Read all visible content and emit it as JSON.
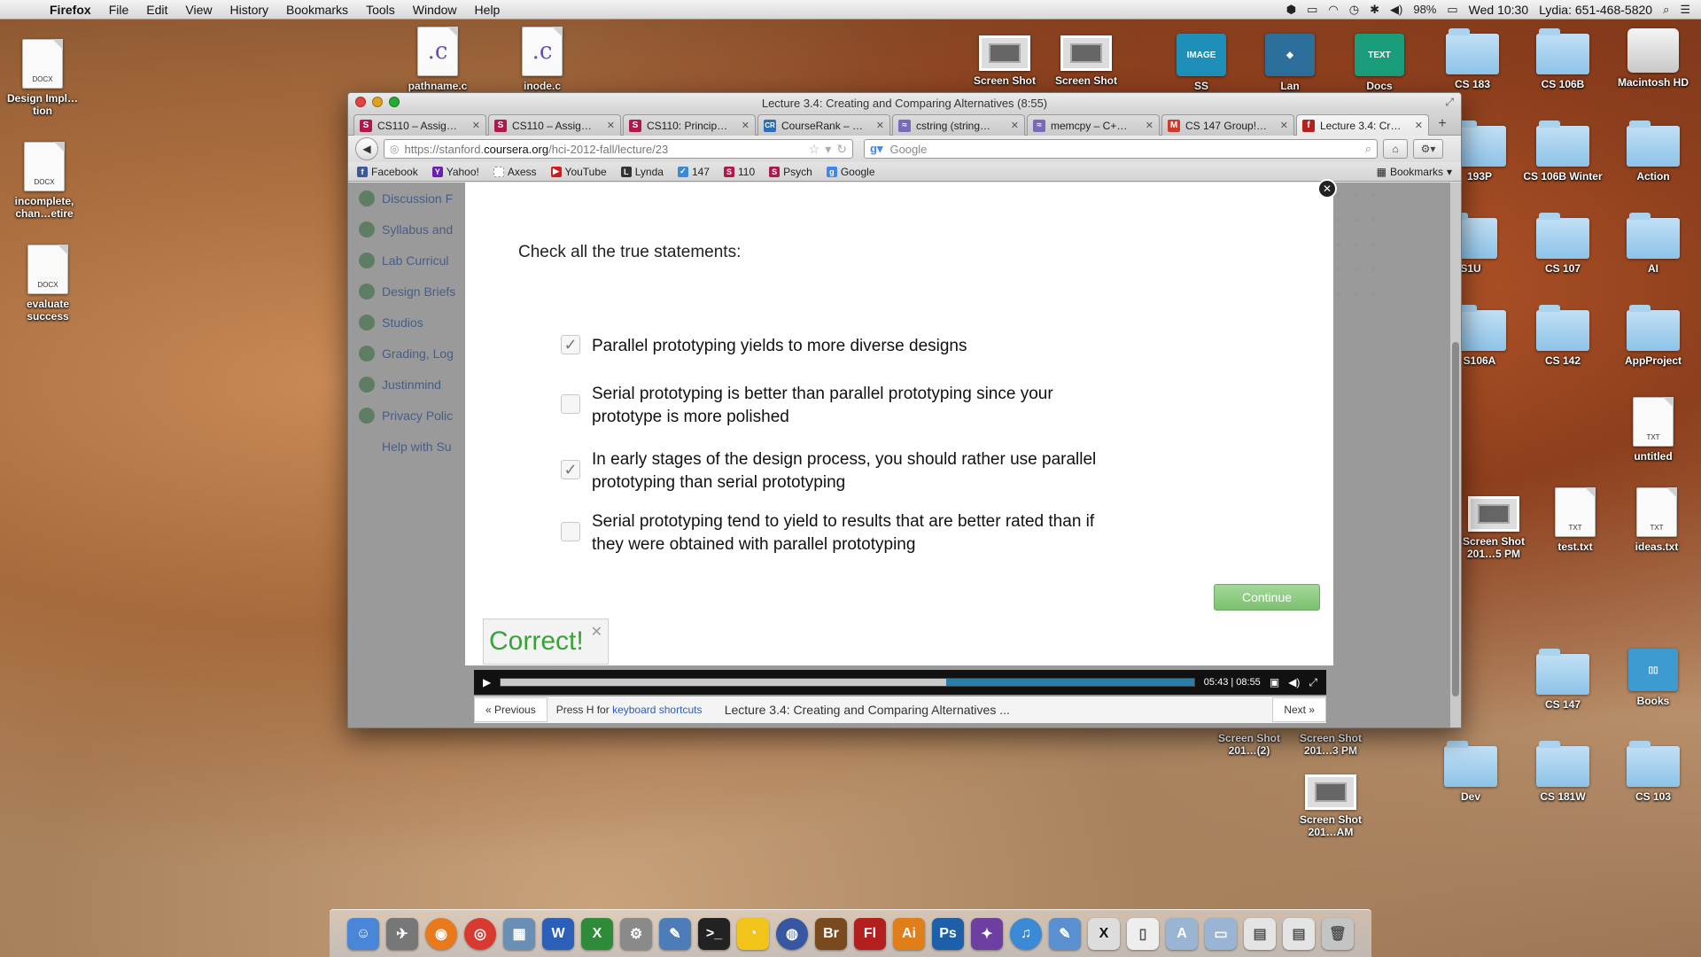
{
  "menubar": {
    "app": "Firefox",
    "items": [
      "File",
      "Edit",
      "View",
      "History",
      "Bookmarks",
      "Tools",
      "Window",
      "Help"
    ],
    "battery": "98%",
    "clock": "Wed 10:30",
    "user": "Lydia: 651-468-5820"
  },
  "desktop": {
    "left": [
      {
        "label": "Design Impl…tion",
        "tag": "DOCX"
      },
      {
        "label": "incomplete, chan…etire",
        "tag": "DOCX"
      },
      {
        "label": "evaluate success",
        "tag": "DOCX"
      }
    ],
    "top": [
      {
        "label": "pathname.c"
      },
      {
        "label": "inode.c"
      },
      {
        "label": "Screen Shot"
      },
      {
        "label": "Screen Shot"
      },
      {
        "label": "SS"
      },
      {
        "label": "Lan"
      },
      {
        "label": "Docs"
      }
    ],
    "grid": [
      {
        "label": "CS 183"
      },
      {
        "label": "CS 106B"
      },
      {
        "label": "Macintosh HD"
      },
      {
        "label": "193P"
      },
      {
        "label": "CS 106B Winter"
      },
      {
        "label": "Action"
      },
      {
        "label": "S1U"
      },
      {
        "label": "CS 107"
      },
      {
        "label": "AI"
      },
      {
        "label": "S106A"
      },
      {
        "label": "CS 142"
      },
      {
        "label": "AppProject"
      },
      {
        "label": "untitled",
        "tag": "TXT"
      },
      {
        "label": "Screen Shot 201…5 PM"
      },
      {
        "label": "test.txt",
        "tag": "TXT"
      },
      {
        "label": "ideas.txt",
        "tag": "TXT"
      },
      {
        "label": "CS 147"
      },
      {
        "label": "Books"
      },
      {
        "label": "Screen Shot 201…(2)"
      },
      {
        "label": "Screen Shot 201…3 PM"
      },
      {
        "label": "Dev"
      },
      {
        "label": "CS 181W"
      },
      {
        "label": "CS 103"
      },
      {
        "label": "Screen Shot 201…AM"
      }
    ]
  },
  "window": {
    "title": "Lecture 3.4: Creating and Comparing Alternatives (8:55)",
    "tabs": [
      {
        "label": "CS110 – Assig…",
        "fav": "S",
        "color": "#b1174f"
      },
      {
        "label": "CS110 – Assig…",
        "fav": "S",
        "color": "#b1174f"
      },
      {
        "label": "CS110: Princip…",
        "fav": "S",
        "color": "#b1174f"
      },
      {
        "label": "CourseRank – …",
        "fav": "CR",
        "color": "#2a6db8"
      },
      {
        "label": "cstring (string…",
        "fav": "≈",
        "color": "#7a68b8"
      },
      {
        "label": "memcpy – C+…",
        "fav": "≈",
        "color": "#7a68b8"
      },
      {
        "label": "CS 147 Group!…",
        "fav": "M",
        "color": "#cf3a2a"
      },
      {
        "label": "Lecture 3.4: Cr…",
        "fav": "f",
        "color": "#b32020"
      }
    ],
    "url": {
      "prefix": "https://stanford.",
      "domain": "coursera.org",
      "path": "/hci-2012-fall/lecture/23"
    },
    "search_placeholder": "Google",
    "bookmarks": [
      {
        "label": "Facebook",
        "color": "#3b5998",
        "g": "f"
      },
      {
        "label": "Yahoo!",
        "color": "#6b1fb1",
        "g": "Y"
      },
      {
        "label": "Axess",
        "color": "#aaaaaa",
        "g": ""
      },
      {
        "label": "YouTube",
        "color": "#d41b1b",
        "g": "▶"
      },
      {
        "label": "Lynda",
        "color": "#333333",
        "g": "L"
      },
      {
        "label": "147",
        "color": "#3a8ad6",
        "g": "c"
      },
      {
        "label": "110",
        "color": "#b1174f",
        "g": "S"
      },
      {
        "label": "Psych",
        "color": "#b1174f",
        "g": "S"
      },
      {
        "label": "Google",
        "color": "#4285f4",
        "g": "g"
      }
    ],
    "bookmarks_menu": "Bookmarks"
  },
  "sidebar": {
    "items": [
      "Discussion F",
      "Syllabus and",
      "Lab Curricul",
      "Design Briefs",
      "Studios",
      "Grading, Log",
      "Justinmind",
      "Privacy Polic",
      "Help with Su"
    ]
  },
  "quiz": {
    "question": "Check all the true statements:",
    "options": [
      {
        "text": "Parallel prototyping yields to more diverse designs",
        "checked": true
      },
      {
        "text": "Serial prototyping is better than parallel prototyping since your prototype is more polished",
        "checked": false
      },
      {
        "text": "In early stages of the design process, you should rather use parallel prototyping than serial prototyping",
        "checked": true
      },
      {
        "text": "Serial prototyping tend to yield to results that are better rated than if they were obtained with parallel prototyping",
        "checked": false
      }
    ],
    "continue_label": "Continue",
    "result": "Correct!"
  },
  "video": {
    "time": "05:43 | 08:55",
    "played_fraction": 0.642,
    "loaded_fraction": 1.0
  },
  "lecture_nav": {
    "prev": "« Previous",
    "help_prefix": "Press H for ",
    "help_link": "keyboard shortcuts",
    "title": "Lecture 3.4: Creating and Comparing Alternatives ...",
    "next": "Next »"
  }
}
